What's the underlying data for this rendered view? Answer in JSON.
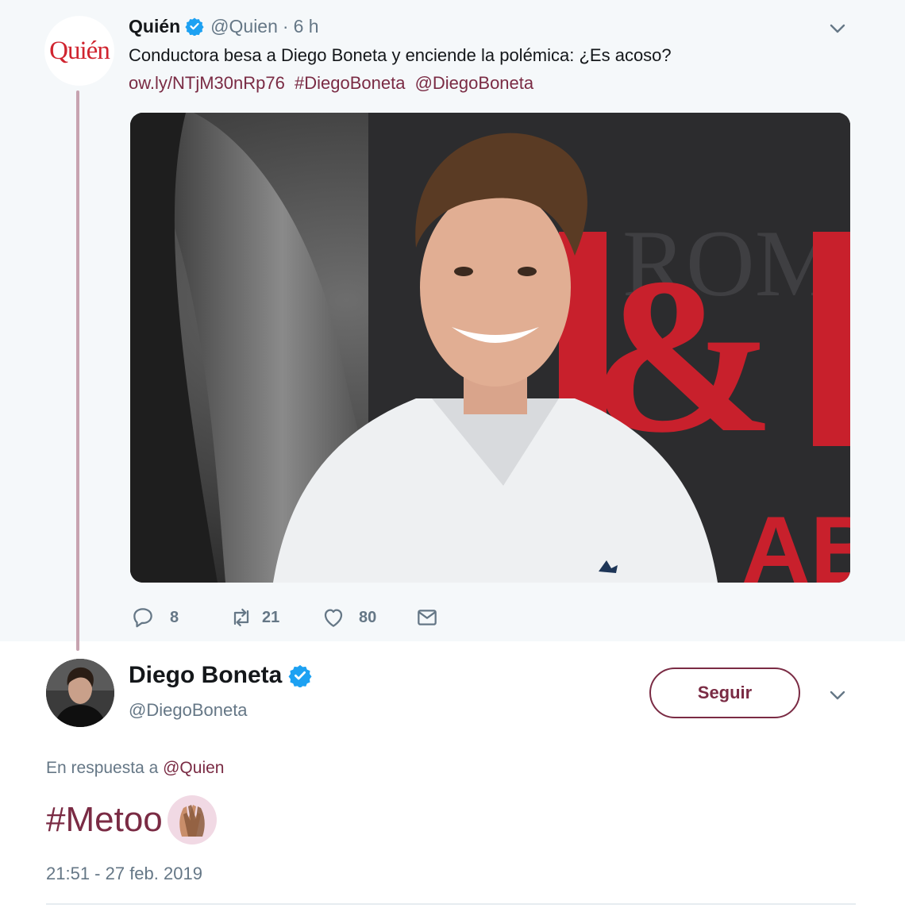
{
  "parent_tweet": {
    "avatar_logo": "Quién",
    "name": "Quién",
    "handle": "@Quien",
    "separator": "·",
    "time": "6 h",
    "text": "Conductora besa a Diego Boneta y enciende la polémica: ¿Es acoso?",
    "link": "ow.ly/NTjM30nRp76",
    "hashtag": "#DiegoBoneta",
    "mention": "@DiegoBoneta",
    "actions": {
      "replies": "8",
      "retweets": "21",
      "likes": "80"
    }
  },
  "reply_tweet": {
    "name": "Diego Boneta",
    "handle": "@DiegoBoneta",
    "follow_label": "Seguir",
    "reply_prefix": "En respuesta a",
    "reply_mention": "@Quien",
    "text": "#Metoo",
    "timestamp": "21:51 - 27 feb. 2019"
  },
  "colors": {
    "accent": "#7a2b44",
    "verified": "#1da1f2",
    "muted": "#657786",
    "logo": "#d0242f"
  },
  "icons": [
    "verified-badge-icon",
    "chevron-down-icon",
    "reply-icon",
    "retweet-icon",
    "like-icon",
    "message-icon",
    "raised-hands-emoji-icon"
  ]
}
